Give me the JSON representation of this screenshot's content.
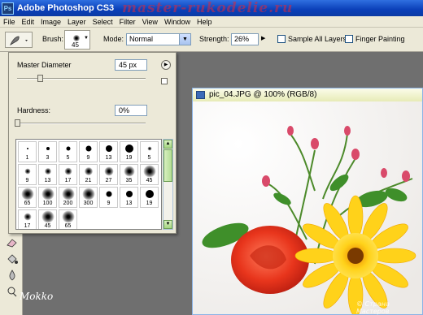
{
  "app": {
    "title": "Adobe Photoshop CS3",
    "logo": "Ps",
    "watermark": "master-rukodelie.ru"
  },
  "menu": [
    "File",
    "Edit",
    "Image",
    "Layer",
    "Select",
    "Filter",
    "View",
    "Window",
    "Help"
  ],
  "options_bar": {
    "brush_label": "Brush:",
    "brush_size": "45",
    "mode_label": "Mode:",
    "mode_value": "Normal",
    "strength_label": "Strength:",
    "strength_value": "26%",
    "sample_all_layers": "Sample All Layers",
    "sample_all_layers_checked": false,
    "finger_painting": "Finger Painting",
    "finger_painting_checked": false
  },
  "brush_picker": {
    "master_diameter_label": "Master Diameter",
    "master_diameter_value": "45 px",
    "master_diameter_level": 0.18,
    "hardness_label": "Hardness:",
    "hardness_value": "0%",
    "hardness_level": 0.0,
    "brushes": [
      {
        "size": "1",
        "soft": false
      },
      {
        "size": "3",
        "soft": false
      },
      {
        "size": "5",
        "soft": false
      },
      {
        "size": "9",
        "soft": false
      },
      {
        "size": "13",
        "soft": false
      },
      {
        "size": "19",
        "soft": false
      },
      {
        "size": "5",
        "soft": true
      },
      {
        "size": "9",
        "soft": true
      },
      {
        "size": "13",
        "soft": true
      },
      {
        "size": "17",
        "soft": true
      },
      {
        "size": "21",
        "soft": true
      },
      {
        "size": "27",
        "soft": true
      },
      {
        "size": "35",
        "soft": true
      },
      {
        "size": "45",
        "soft": true
      },
      {
        "size": "65",
        "soft": true
      },
      {
        "size": "100",
        "soft": true
      },
      {
        "size": "200",
        "soft": true
      },
      {
        "size": "300",
        "soft": true
      },
      {
        "size": "9",
        "soft": false
      },
      {
        "size": "13",
        "soft": false
      },
      {
        "size": "19",
        "soft": false
      },
      {
        "size": "17",
        "soft": true
      },
      {
        "size": "45",
        "soft": true
      },
      {
        "size": "65",
        "soft": true
      }
    ]
  },
  "document": {
    "title": "pic_04.JPG @ 100% (RGB/8)"
  },
  "signature": "Mokko",
  "site_watermark": "© Страна Мастеров"
}
